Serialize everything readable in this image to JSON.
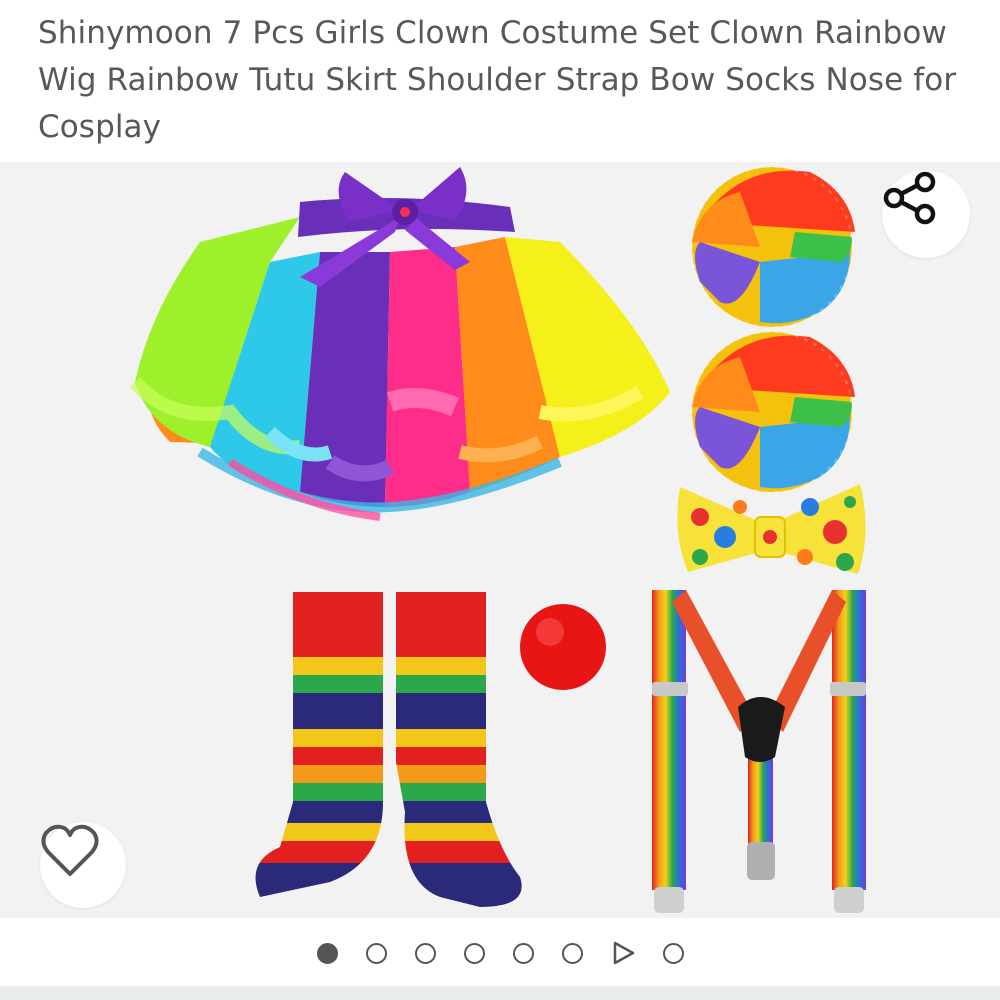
{
  "product": {
    "title": "Shinymoon 7 Pcs Girls Clown Costume Set Clown Rainbow Wig Rainbow Tutu Skirt Shoulder Strap Bow Socks Nose for Cosplay"
  },
  "gallery": {
    "image_items": [
      "rainbow-tutu-skirt",
      "rainbow-clown-wig",
      "rainbow-clown-wig",
      "polka-dot-bow-tie",
      "rainbow-striped-socks",
      "red-clown-nose",
      "rainbow-suspenders"
    ],
    "total_slides": 8,
    "active_index": 0,
    "video_slide_index": 6
  },
  "icons": {
    "share": "share-icon",
    "favorite": "heart-icon",
    "video": "play-icon"
  },
  "colors": {
    "title_text": "#565959",
    "gallery_bg": "#f2f2f2",
    "dot": "#555555"
  }
}
